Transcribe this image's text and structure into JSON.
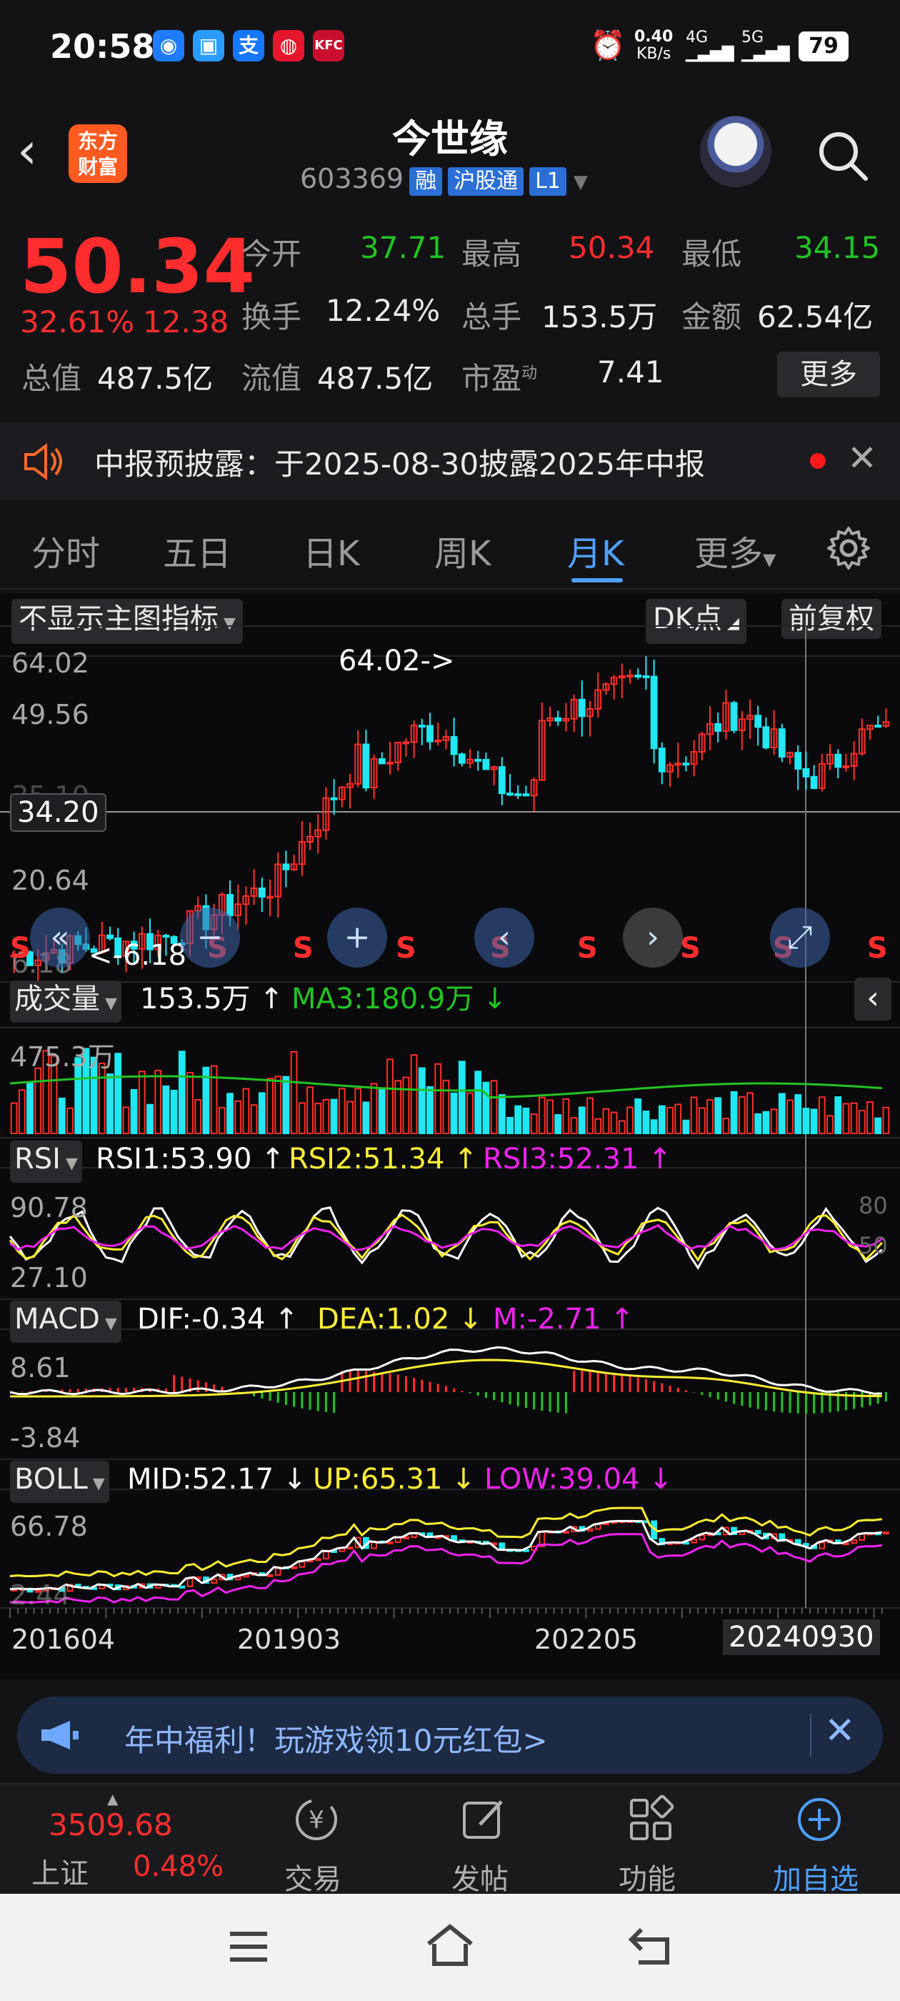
{
  "status": {
    "time": "20:58",
    "speed": "0.40",
    "speed_unit": "KB/s",
    "net1": "4G",
    "net2": "5G",
    "battery": "79"
  },
  "app_badge": "东方\n财富",
  "header": {
    "title": "今世缘",
    "code": "603369",
    "tag_margin": "融",
    "tag_connect": "沪股通",
    "tag_level": "L1"
  },
  "quote": {
    "price": "50.34",
    "change_pct": "32.61%",
    "change": "12.38",
    "open_label": "今开",
    "open": "37.71",
    "high_label": "最高",
    "high": "50.34",
    "low_label": "最低",
    "low": "34.15",
    "turnover_label": "换手",
    "turnover": "12.24%",
    "volume_label": "总手",
    "volume": "153.5万",
    "amount_label": "金额",
    "amount": "62.54亿",
    "mktcap_label": "总值",
    "mktcap": "487.5亿",
    "float_label": "流值",
    "float": "487.5亿",
    "pe_label": "市盈",
    "pe_sup": "动",
    "pe": "7.41",
    "more": "更多"
  },
  "notice": {
    "text": "中报预披露：于2025-08-30披露2025年中报"
  },
  "tabs": [
    {
      "label": "分时"
    },
    {
      "label": "五日"
    },
    {
      "label": "日K"
    },
    {
      "label": "周K"
    },
    {
      "label": "月K"
    },
    {
      "label": "更多"
    }
  ],
  "chart_header": {
    "indicator_select": "不显示主图指标",
    "dk": "DK点",
    "adjust": "前复权"
  },
  "main_chart": {
    "axis": [
      "64.02",
      "49.56",
      "35.10",
      "20.64",
      "6.18"
    ],
    "crosshair_label": "34.20",
    "max_label": "64.02->",
    "min_label": "<-6.18",
    "signal": "S"
  },
  "vol": {
    "label": "成交量",
    "value": "153.5万 ↑",
    "ma": "MA3:180.9万 ↓",
    "axis_top": "475.3万"
  },
  "rsi": {
    "label": "RSI",
    "r1": "RSI1:53.90 ↑",
    "r2": "RSI2:51.34 ↑",
    "r3": "RSI3:52.31 ↑",
    "axis_top": "90.78",
    "axis_bot": "27.10",
    "lvl80": "80",
    "lvl50": "50"
  },
  "macd": {
    "label": "MACD",
    "dif": "DIF:-0.34 ↑",
    "dea": "DEA:1.02 ↓",
    "m": "M:-2.71 ↑",
    "axis_top": "8.61",
    "axis_bot": "-3.84"
  },
  "boll": {
    "label": "BOLL",
    "mid": "MID:52.17 ↓",
    "up": "UP:65.31 ↓",
    "low": "LOW:39.04 ↓",
    "axis_top": "66.78",
    "axis_bot": "2.44"
  },
  "dates": [
    "201604",
    "201903",
    "202205",
    "20240930"
  ],
  "promo": {
    "text": "年中福利！玩游戏领10元红包>"
  },
  "bottom": {
    "index_value": "3509.68",
    "index_name": "上证",
    "index_change": "0.48%",
    "items": [
      {
        "label": "交易"
      },
      {
        "label": "发帖"
      },
      {
        "label": "功能"
      },
      {
        "label": "加自选"
      }
    ]
  },
  "colors": {
    "up": "#ff2d2d",
    "down": "#22e6f0",
    "ma": "#22c322",
    "yellow": "#ffee33",
    "magenta": "#ee22ee"
  }
}
